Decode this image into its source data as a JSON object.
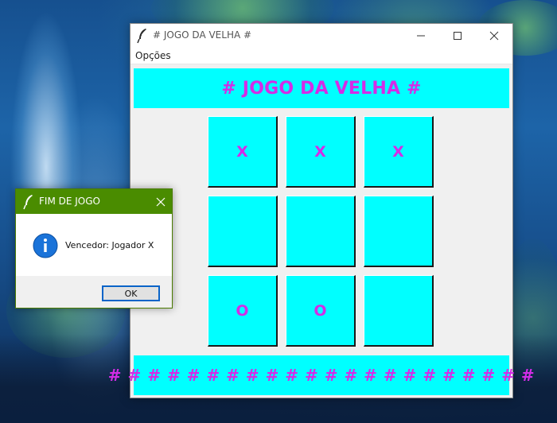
{
  "window": {
    "title": "# JOGO DA VELHA #"
  },
  "menu": {
    "items": [
      {
        "label": "Opções"
      }
    ]
  },
  "header": {
    "text": "# JOGO DA VELHA #"
  },
  "board": {
    "cells": [
      "X",
      "X",
      "X",
      "",
      "",
      "",
      "O",
      "O",
      ""
    ]
  },
  "footer": {
    "text": "# # # # # # # # # # # # # # # # # # # # # #"
  },
  "dialog": {
    "title": "FIM DE JOGO",
    "message": "Vencedor: Jogador X",
    "ok_label": "OK",
    "icon": "info-icon"
  },
  "colors": {
    "cyan_fill": "#00ffff",
    "magenta_text": "#d42ce6",
    "dialog_titlebar": "#4a8c00",
    "info_blue": "#1a73d9"
  },
  "icons": {
    "app": "feather-icon",
    "minimize": "minimize-icon",
    "maximize": "maximize-icon",
    "close": "close-icon"
  }
}
